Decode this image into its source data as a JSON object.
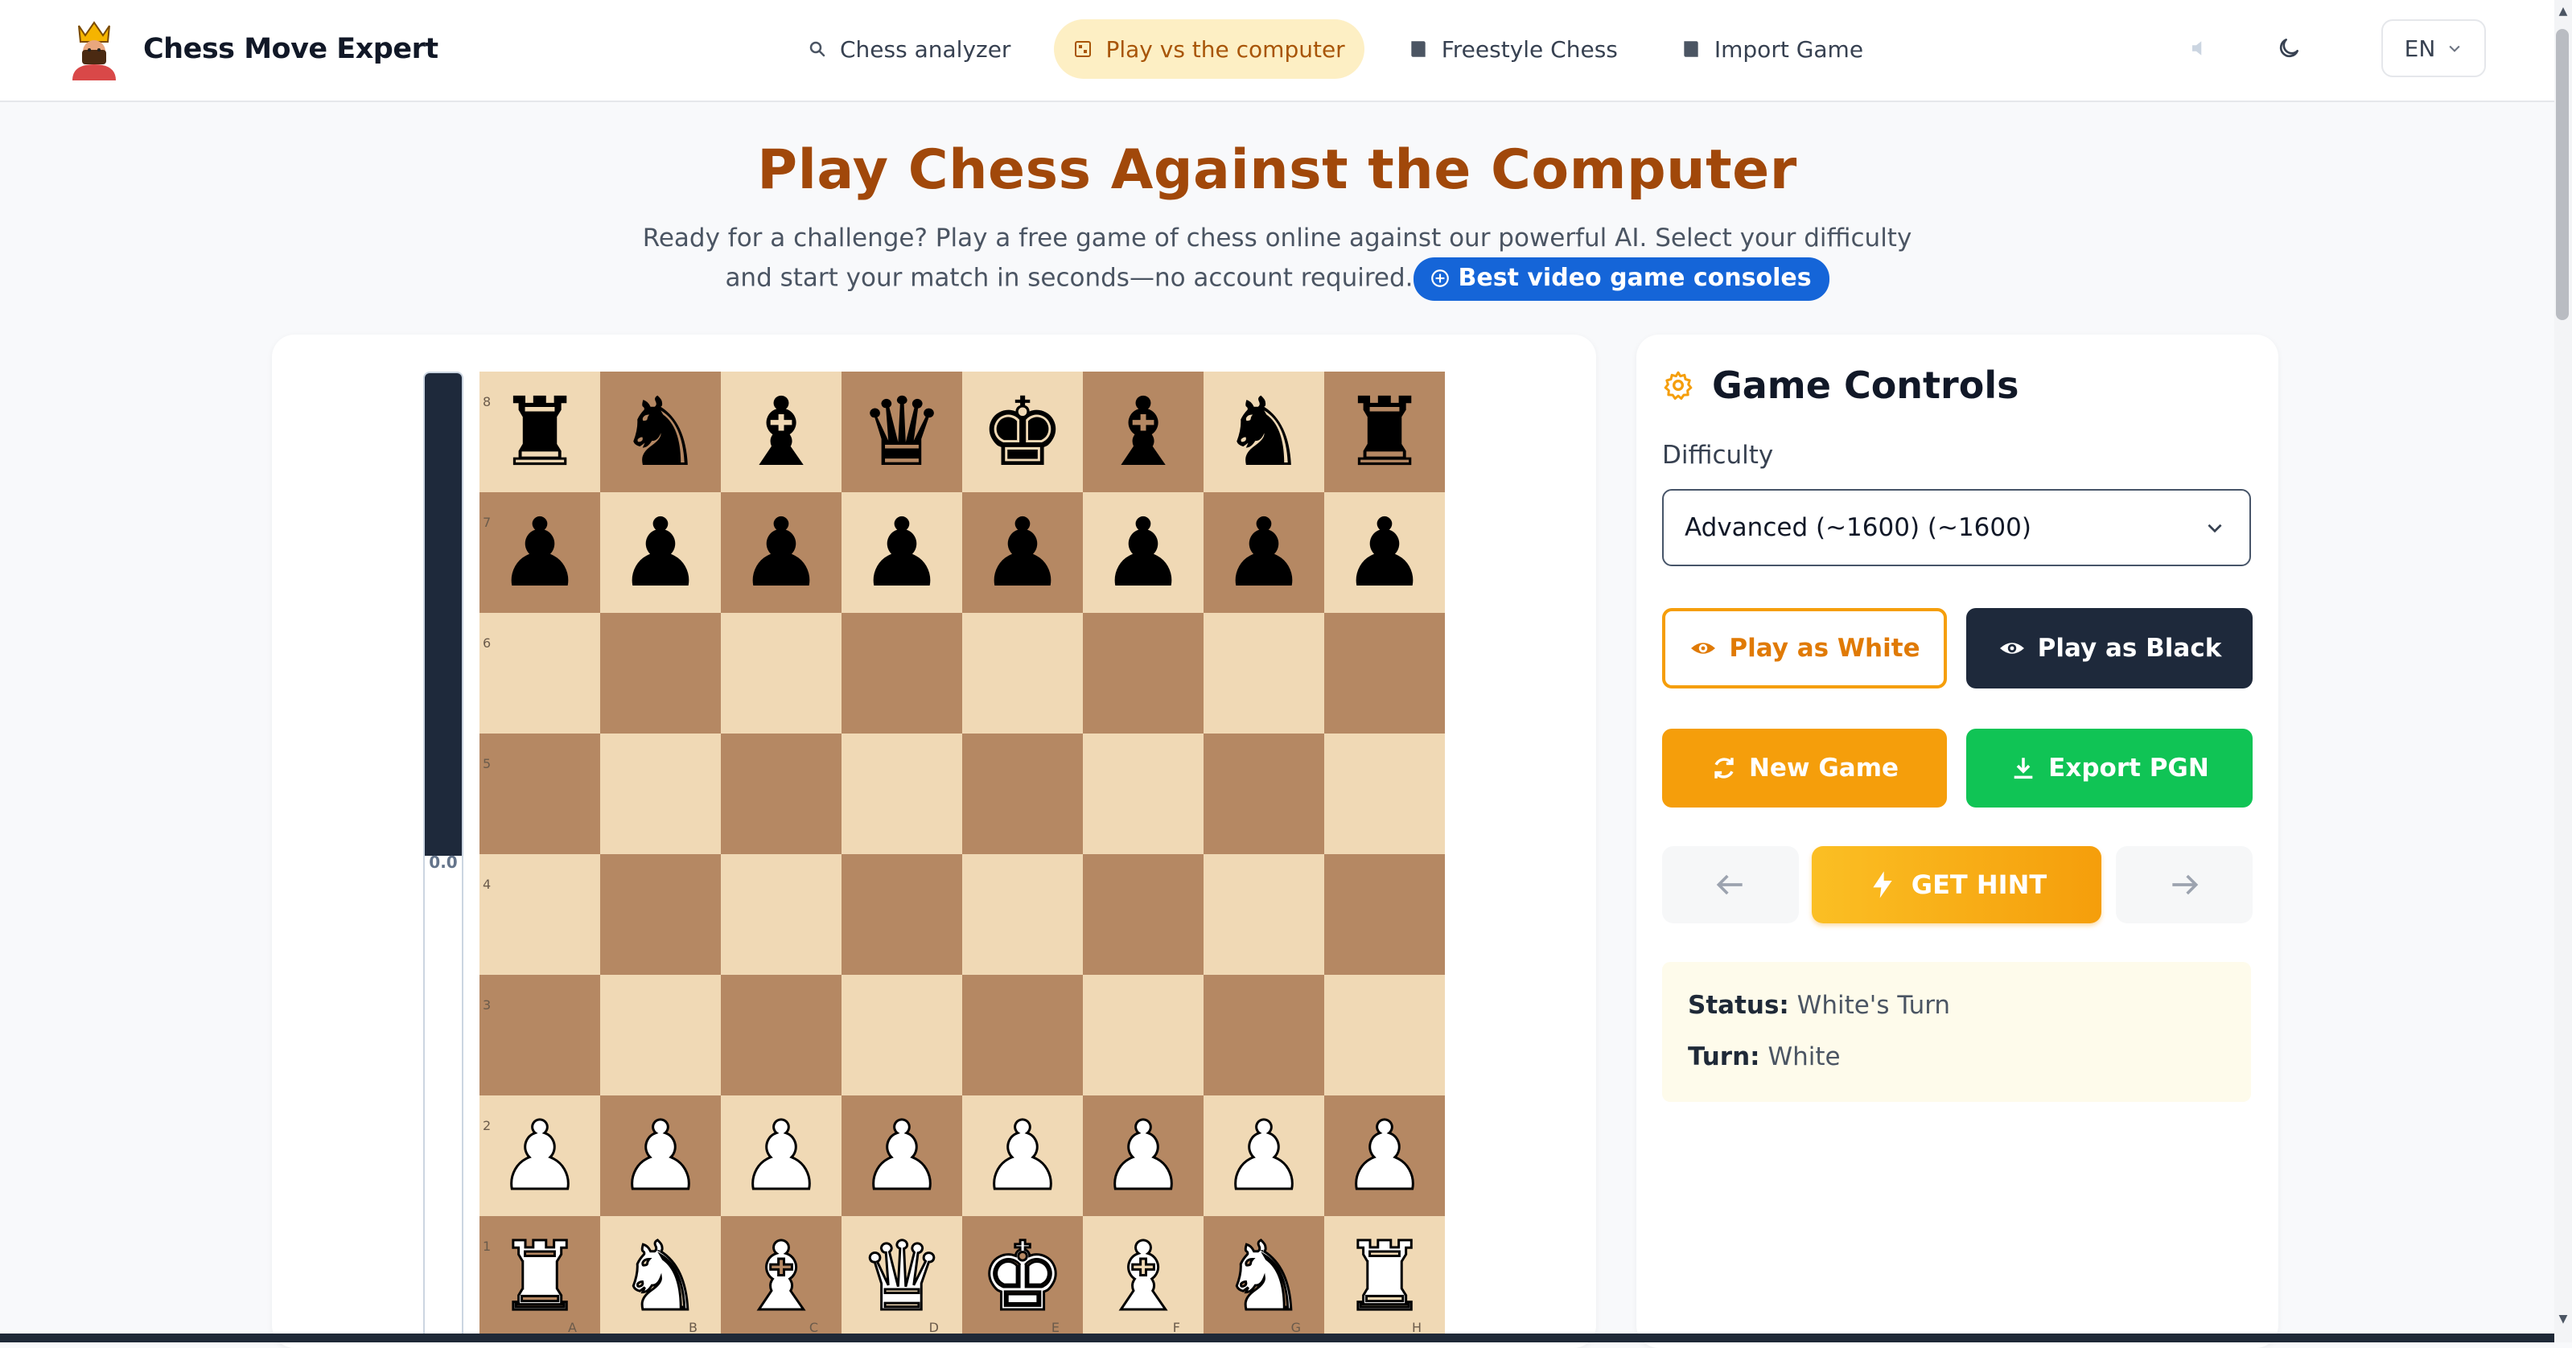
{
  "header": {
    "app_title": "Chess Move Expert",
    "nav": [
      {
        "label": "Chess analyzer",
        "icon": "search-icon",
        "active": false
      },
      {
        "label": "Play vs the computer",
        "icon": "board-icon",
        "active": true
      },
      {
        "label": "Freestyle Chess",
        "icon": "book-icon",
        "active": false
      },
      {
        "label": "Import Game",
        "icon": "book-icon",
        "active": false
      }
    ],
    "sound_icon": "speaker-muted-icon",
    "theme_icon": "moon-icon",
    "language": "EN"
  },
  "hero": {
    "title": "Play Chess Against the Computer",
    "subtitle": "Ready for a challenge? Play a free game of chess online against our powerful AI. Select your difficulty and start your match in seconds—no account required.",
    "promo_label": "Best video game consoles"
  },
  "evaluation": {
    "label": "0.0",
    "black_fraction": 0.5
  },
  "board": {
    "ranks": [
      "8",
      "7",
      "6",
      "5",
      "4",
      "3",
      "2",
      "1"
    ],
    "files": [
      "A",
      "B",
      "C",
      "D",
      "E",
      "F",
      "G",
      "H"
    ],
    "position": [
      [
        "r",
        "n",
        "b",
        "q",
        "k",
        "b",
        "n",
        "r"
      ],
      [
        "p",
        "p",
        "p",
        "p",
        "p",
        "p",
        "p",
        "p"
      ],
      [
        "",
        "",
        "",
        "",
        "",
        "",
        "",
        ""
      ],
      [
        "",
        "",
        "",
        "",
        "",
        "",
        "",
        ""
      ],
      [
        "",
        "",
        "",
        "",
        "",
        "",
        "",
        ""
      ],
      [
        "",
        "",
        "",
        "",
        "",
        "",
        "",
        ""
      ],
      [
        "P",
        "P",
        "P",
        "P",
        "P",
        "P",
        "P",
        "P"
      ],
      [
        "R",
        "N",
        "B",
        "Q",
        "K",
        "B",
        "N",
        "R"
      ]
    ],
    "light_color": "#f0d9b5",
    "dark_color": "#b58863"
  },
  "controls": {
    "title": "Game Controls",
    "difficulty_label": "Difficulty",
    "difficulty_value": "Advanced (~1600) (~1600)",
    "play_white_label": "Play as White",
    "play_black_label": "Play as Black",
    "new_game_label": "New Game",
    "export_label": "Export PGN",
    "hint_label": "GET HINT",
    "status_key": "Status:",
    "status_value": "White's Turn",
    "turn_key": "Turn:",
    "turn_value": "White"
  },
  "colors": {
    "accent": "#f59e0b",
    "title": "#a1480a",
    "dark_button": "#1e293b",
    "export_green": "#10c455",
    "promo_blue": "#1565d8"
  }
}
